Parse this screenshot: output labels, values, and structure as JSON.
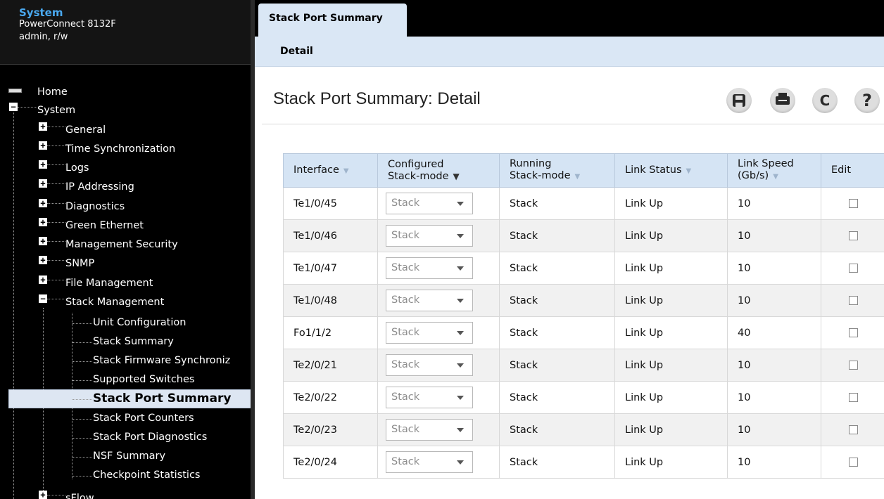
{
  "app": {
    "section": "System",
    "model": "PowerConnect 8132F",
    "user": "admin, r/w"
  },
  "nav": {
    "home": "Home",
    "system": "System",
    "items": [
      "General",
      "Time Synchronization",
      "Logs",
      "IP Addressing",
      "Diagnostics",
      "Green Ethernet",
      "Management Security",
      "SNMP",
      "File Management",
      "Stack Management"
    ],
    "stack_items": [
      "Unit Configuration",
      "Stack Summary",
      "Stack Firmware Synchroniz",
      "Supported Switches",
      "Stack Port Summary",
      "Stack Port Counters",
      "Stack Port Diagnostics",
      "NSF Summary",
      "Checkpoint Statistics"
    ],
    "after": "sFlow"
  },
  "tabs": {
    "active": "Stack Port Summary",
    "sub": "Detail"
  },
  "page": {
    "title": "Stack Port Summary: Detail"
  },
  "toolbar": {
    "save_icon": "save-icon",
    "print_icon": "print-icon",
    "refresh_glyph": "C",
    "help_glyph": "?"
  },
  "table": {
    "headers": {
      "interface": "Interface",
      "configured_1": "Configured",
      "configured_2": "Stack-mode",
      "running_1": "Running",
      "running_2": "Stack-mode",
      "link_status": "Link Status",
      "speed_1": "Link Speed",
      "speed_2": "(Gb/s)",
      "edit": "Edit"
    },
    "sort_glyph": "▼",
    "rows": [
      {
        "interface": "Te1/0/45",
        "configured": "Stack",
        "running": "Stack",
        "status": "Link Up",
        "speed": "10"
      },
      {
        "interface": "Te1/0/46",
        "configured": "Stack",
        "running": "Stack",
        "status": "Link Up",
        "speed": "10"
      },
      {
        "interface": "Te1/0/47",
        "configured": "Stack",
        "running": "Stack",
        "status": "Link Up",
        "speed": "10"
      },
      {
        "interface": "Te1/0/48",
        "configured": "Stack",
        "running": "Stack",
        "status": "Link Up",
        "speed": "10"
      },
      {
        "interface": "Fo1/1/2",
        "configured": "Stack",
        "running": "Stack",
        "status": "Link Up",
        "speed": "40"
      },
      {
        "interface": "Te2/0/21",
        "configured": "Stack",
        "running": "Stack",
        "status": "Link Up",
        "speed": "10"
      },
      {
        "interface": "Te2/0/22",
        "configured": "Stack",
        "running": "Stack",
        "status": "Link Up",
        "speed": "10"
      },
      {
        "interface": "Te2/0/23",
        "configured": "Stack",
        "running": "Stack",
        "status": "Link Up",
        "speed": "10"
      },
      {
        "interface": "Te2/0/24",
        "configured": "Stack",
        "running": "Stack",
        "status": "Link Up",
        "speed": "10"
      }
    ]
  }
}
